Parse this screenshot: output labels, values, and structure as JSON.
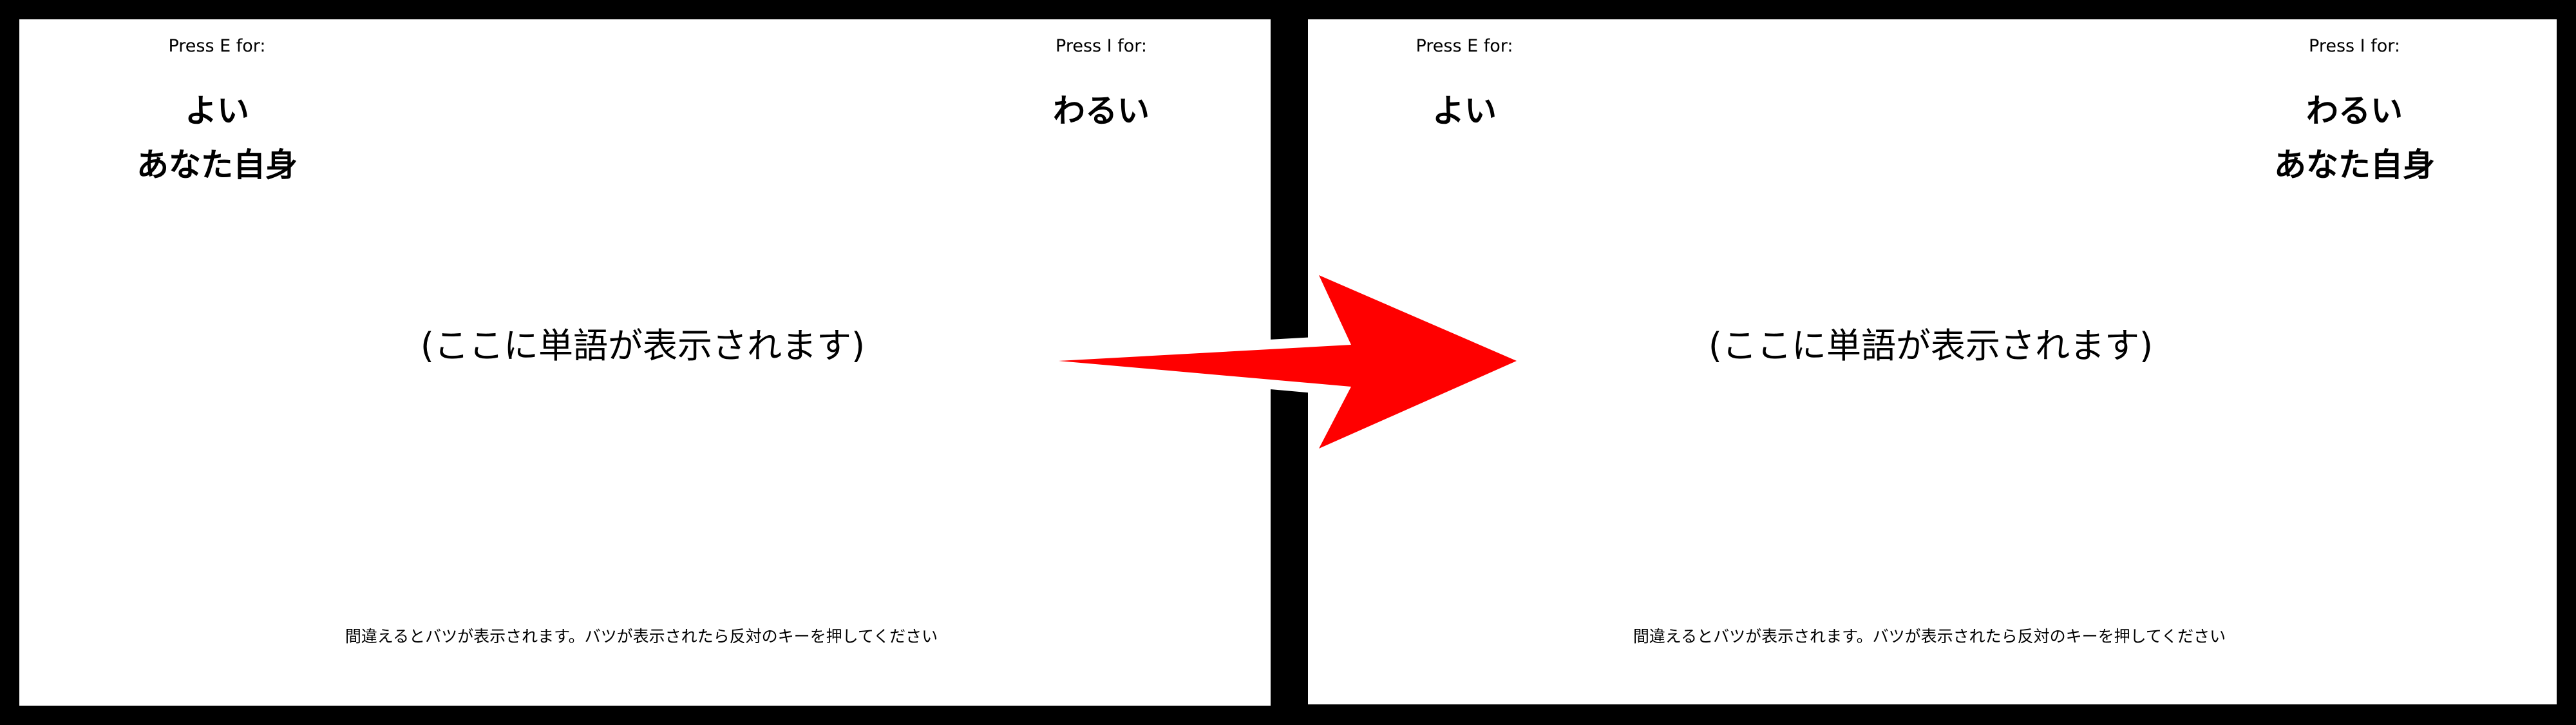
{
  "colors": {
    "background": "#000000",
    "panel": "#ffffff",
    "arrow": "#ff0000",
    "arrow_outline": "#ffffff"
  },
  "icons": {
    "transition": "right-arrow-icon"
  },
  "screens": [
    {
      "left_key": "Press E for:",
      "right_key": "Press I for:",
      "left_category": [
        "よい",
        "あなた自身"
      ],
      "right_category": [
        "わるい"
      ],
      "stimulus_placeholder": "(ここに単語が表示されます)",
      "instruction": "間違えるとバツが表示されます。バツが表示されたら反対のキーを押してください"
    },
    {
      "left_key": "Press E for:",
      "right_key": "Press I for:",
      "left_category": [
        "よい"
      ],
      "right_category": [
        "わるい",
        "あなた自身"
      ],
      "stimulus_placeholder": "(ここに単語が表示されます)",
      "instruction": "間違えるとバツが表示されます。バツが表示されたら反対のキーを押してください"
    }
  ]
}
